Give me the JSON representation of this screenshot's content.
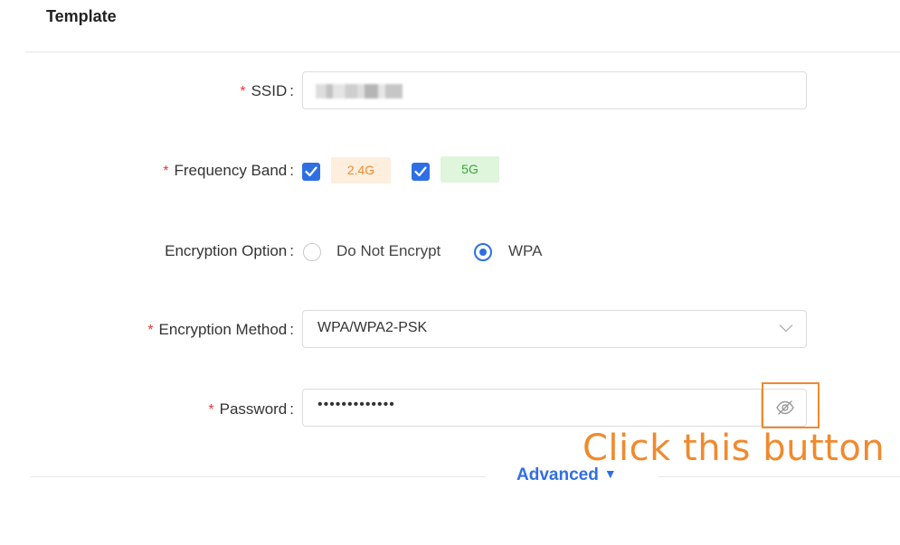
{
  "section": {
    "title": "Template"
  },
  "form": {
    "required_mark": "*",
    "colon": ":",
    "ssid": {
      "label": "SSID",
      "value": ""
    },
    "frequency_band": {
      "label": "Frequency Band",
      "options": [
        {
          "label": "2.4G",
          "checked": true
        },
        {
          "label": "5G",
          "checked": true
        }
      ]
    },
    "encryption_option": {
      "label": "Encryption Option",
      "options": [
        "Do Not Encrypt",
        "WPA"
      ],
      "selected": "WPA"
    },
    "encryption_method": {
      "label": "Encryption Method",
      "value": "WPA/WPA2-PSK"
    },
    "password": {
      "label": "Password",
      "value": "•••••••••••••"
    }
  },
  "advanced": {
    "label": "Advanced"
  },
  "annotation": {
    "text": "Click this button"
  },
  "colors": {
    "accent": "#2f6fe4",
    "annotation": "#f08a2e",
    "required": "#e53935"
  },
  "icons": {
    "eye_toggle": "eye-off-icon",
    "select_arrow": "chevron-down-icon",
    "advanced_arrow": "caret-down-icon"
  }
}
